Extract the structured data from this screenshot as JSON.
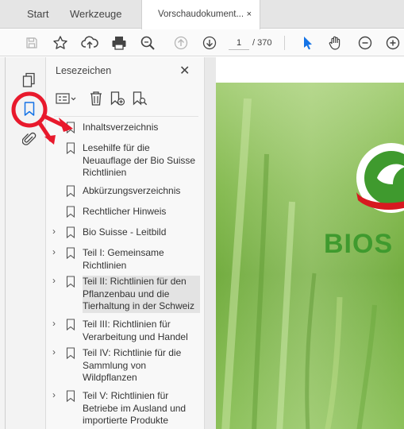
{
  "tabs": {
    "start": "Start",
    "tools": "Werkzeuge",
    "document": "Vorschaudokument...",
    "close_glyph": "×"
  },
  "toolbar": {
    "page_current": "1",
    "page_total": "/ 370",
    "icons": [
      "save-icon",
      "bookmark-star-icon",
      "upload-cloud-icon",
      "print-icon",
      "zoom-search-icon",
      "page-up-icon",
      "page-down-icon",
      "select-pointer-icon",
      "hand-icon",
      "zoom-out-icon",
      "zoom-in-icon"
    ]
  },
  "bookmarks_panel": {
    "title": "Lesezeichen",
    "close_glyph": "✕",
    "items": [
      {
        "label": "Inhaltsverzeichnis",
        "expandable": false,
        "selected": false
      },
      {
        "label": "Lesehilfe für die Neuauflage der Bio Suisse Richtlinien",
        "expandable": false,
        "selected": false
      },
      {
        "label": "Abkürzungsverzeichnis",
        "expandable": false,
        "selected": false
      },
      {
        "label": "Rechtlicher Hinweis",
        "expandable": false,
        "selected": false
      },
      {
        "label": "Bio Suisse - Leitbild",
        "expandable": true,
        "selected": false
      },
      {
        "label": "Teil I: Gemeinsame Richtlinien",
        "expandable": true,
        "selected": false
      },
      {
        "label": "Teil II: Richtlinien für den Pflanzenbau und die Tierhaltung in der Schweiz",
        "expandable": true,
        "selected": true
      },
      {
        "label": "Teil III: Richtlinien für Verarbeitung und Handel",
        "expandable": true,
        "selected": false
      },
      {
        "label": "Teil IV: Richtlinie für die Sammlung von Wildpflanzen",
        "expandable": true,
        "selected": false
      },
      {
        "label": "Teil V: Richtlinien für Betriebe im Ausland und importierte Produkte",
        "expandable": true,
        "selected": false
      }
    ],
    "chevron_glyph": "›"
  },
  "document": {
    "logo_text": "BIOS"
  },
  "colors": {
    "annotation_red": "#e8192c",
    "accent_blue": "#1473e6",
    "logo_green": "#3f9a2e",
    "logo_red": "#d71920"
  }
}
